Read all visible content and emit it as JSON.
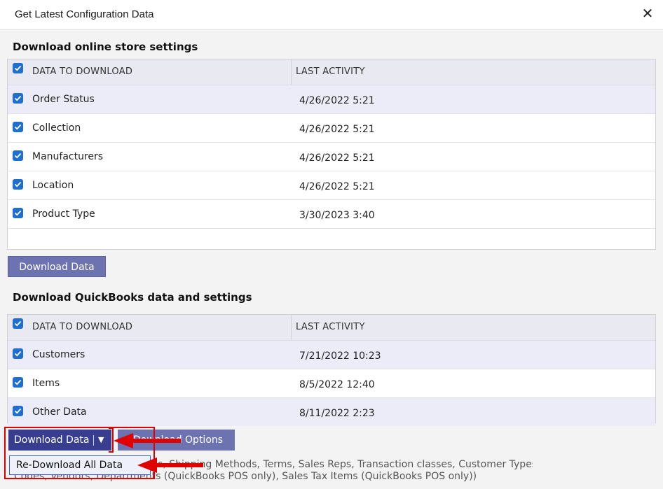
{
  "window": {
    "title": "Get Latest Configuration Data",
    "close_symbol": "✕"
  },
  "store_section": {
    "title": "Download online store settings",
    "columns": [
      "DATA TO DOWNLOAD",
      "LAST ACTIVITY"
    ],
    "rows": [
      {
        "name": "Order Status",
        "last": "4/26/2022 5:21",
        "checked": true
      },
      {
        "name": "Collection",
        "last": "4/26/2022 5:21",
        "checked": true
      },
      {
        "name": "Manufacturers",
        "last": "4/26/2022 5:21",
        "checked": true
      },
      {
        "name": "Location",
        "last": "4/26/2022 5:21",
        "checked": true
      },
      {
        "name": "Product Type",
        "last": "3/30/2023 3:40",
        "checked": true
      }
    ],
    "button_label": "Download Data"
  },
  "qb_section": {
    "title": "Download QuickBooks data and settings",
    "columns": [
      "DATA TO DOWNLOAD",
      "LAST ACTIVITY"
    ],
    "rows": [
      {
        "name": "Customers",
        "last": "7/21/2022 10:23",
        "checked": true
      },
      {
        "name": "Items",
        "last": "8/5/2022 12:40",
        "checked": true
      },
      {
        "name": "Other Data",
        "last": "8/11/2022 2:23",
        "checked": true
      }
    ],
    "split_button_label": "Download Data",
    "split_button_caret": "▼",
    "options_button_label": "Download Options",
    "dropdown_item": "Re-Download All Data",
    "info_line1": "Other Data: Payment Methods, Shipping Methods, Terms, Sales Reps, Transaction classes, Customer Types, Sales Tax",
    "info_line2": "Codes, Vendors, Departments (QuickBooks POS only), Sales Tax Items (QuickBooks POS only))"
  },
  "colors": {
    "accent": "#383d8f",
    "button": "#6d72b0",
    "checkbox": "#1f6fd1",
    "annotation": "#e00000"
  }
}
